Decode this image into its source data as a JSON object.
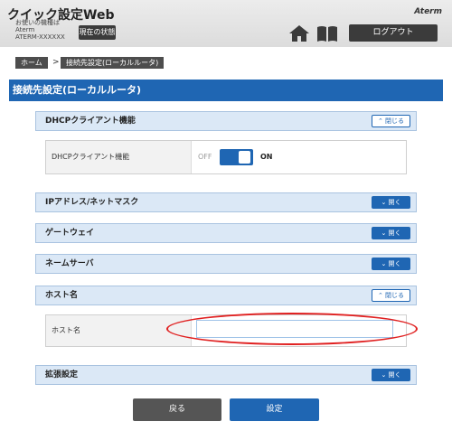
{
  "header": {
    "app_title": "クイック設定Web",
    "model_label": "お使いの機種は",
    "model_line": "Aterm",
    "model_id": "ATERM-XXXXXX",
    "status_button": "現在の状態",
    "brand": "Aterm",
    "logout_button": "ログアウト",
    "home_icon": "home-icon",
    "manual_icon": "book-icon"
  },
  "breadcrumb": {
    "home": "ホーム",
    "separator": ">",
    "current": "接続先設定(ローカルルータ)"
  },
  "page": {
    "title": "接続先設定(ローカルルータ)"
  },
  "sections": {
    "dhcp": {
      "label": "DHCPクライアント機能",
      "button": "閉じる"
    },
    "ip": {
      "label": "IPアドレス/ネットマスク",
      "button": "開く"
    },
    "gateway": {
      "label": "ゲートウェイ",
      "button": "開く"
    },
    "nameserver": {
      "label": "ネームサーバ",
      "button": "開く"
    },
    "hostname": {
      "label": "ホスト名",
      "button": "閉じる"
    },
    "extended": {
      "label": "拡張設定",
      "button": "開く"
    }
  },
  "dhcp_panel": {
    "label": "DHCPクライアント機能",
    "off_label": "OFF",
    "on_label": "ON",
    "value": "ON"
  },
  "hostname_panel": {
    "label": "ホスト名",
    "value": ""
  },
  "footer": {
    "back_button": "戻る",
    "set_button": "設定"
  },
  "colors": {
    "accent": "#1f66b3",
    "section_bg": "#dbe8f6",
    "highlight": "#e02020"
  }
}
